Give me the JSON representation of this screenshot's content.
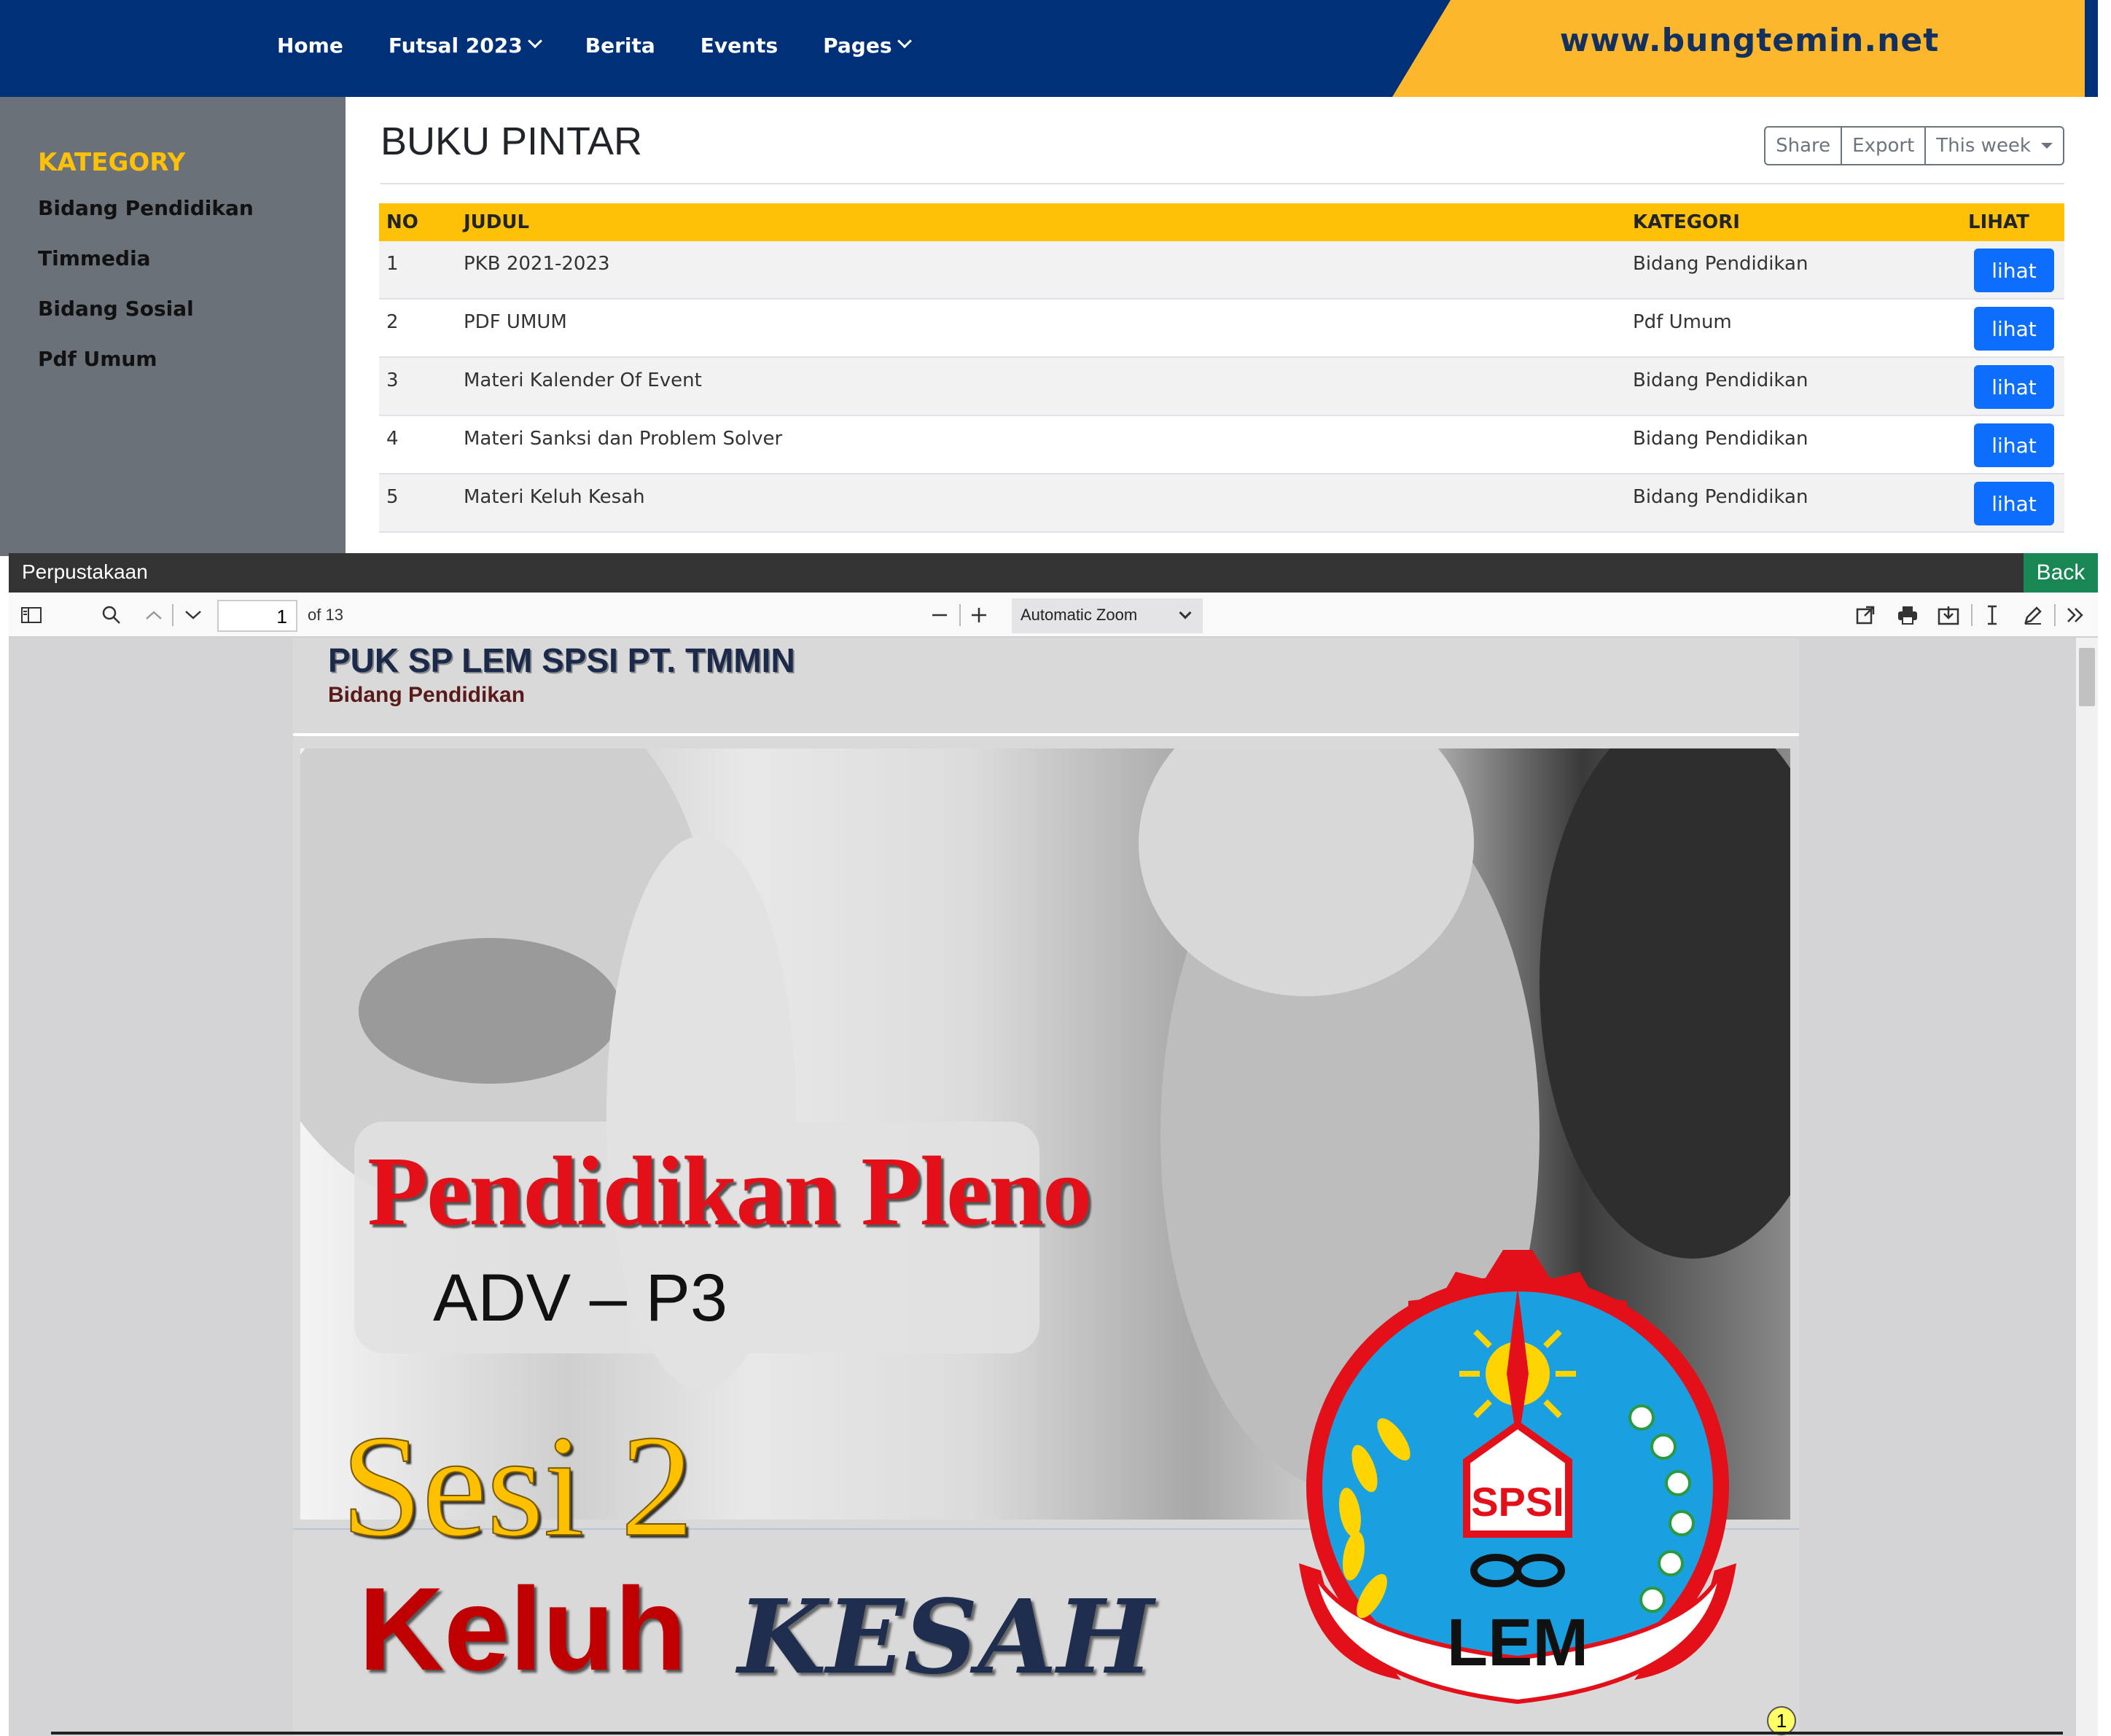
{
  "header": {
    "nav": [
      {
        "label": "Home",
        "dropdown": false
      },
      {
        "label": "Futsal 2023",
        "dropdown": true
      },
      {
        "label": "Berita",
        "dropdown": false
      },
      {
        "label": "Events",
        "dropdown": false
      },
      {
        "label": "Pages",
        "dropdown": true
      }
    ],
    "site_url": "www.bungtemin.net",
    "colors": {
      "navy": "#003178",
      "gold": "#fcb72c"
    }
  },
  "sidebar": {
    "title": "KATEGORY",
    "items": [
      "Bidang Pendidikan",
      "Timmedia",
      "Bidang Sosial",
      "Pdf Umum"
    ]
  },
  "main": {
    "title": "BUKU PINTAR",
    "toolbar": {
      "share": "Share",
      "export": "Export",
      "period": "This week"
    },
    "table": {
      "headers": {
        "no": "NO",
        "judul": "JUDUL",
        "kategori": "KATEGORI",
        "lihat": "LIHAT"
      },
      "rows": [
        {
          "no": "1",
          "judul": "PKB 2021-2023",
          "kategori": "Bidang Pendidikan",
          "action": "lihat"
        },
        {
          "no": "2",
          "judul": "PDF UMUM",
          "kategori": "Pdf Umum",
          "action": "lihat"
        },
        {
          "no": "3",
          "judul": "Materi Kalender Of Event",
          "kategori": "Bidang Pendidikan",
          "action": "lihat"
        },
        {
          "no": "4",
          "judul": "Materi Sanksi dan Problem Solver",
          "kategori": "Bidang Pendidikan",
          "action": "lihat"
        },
        {
          "no": "5",
          "judul": "Materi Keluh Kesah",
          "kategori": "Bidang Pendidikan",
          "action": "lihat"
        }
      ]
    }
  },
  "viewer": {
    "title": "Perpustakaan",
    "back": "Back",
    "page_input": "1",
    "page_count": "of 13",
    "zoom": "Automatic Zoom",
    "icons": [
      "sidebar-toggle-icon",
      "search-icon",
      "previous-page-icon",
      "next-page-icon",
      "zoom-out-icon",
      "zoom-in-icon",
      "open-file-icon",
      "print-icon",
      "download-icon",
      "text-select-icon",
      "draw-icon",
      "more-tools-icon"
    ]
  },
  "document": {
    "org": "PUK SP LEM SPSI PT. TMMIN",
    "division": "Bidang Pendidikan",
    "headline": "Pendidikan Pleno",
    "subheadline": "ADV – P3",
    "session": "Sesi 2",
    "topic_word1": "Keluh",
    "topic_word2": "KESAH",
    "logo_text_top": "SPSI",
    "logo_text_bottom": "LEM",
    "page_badge": "1"
  }
}
